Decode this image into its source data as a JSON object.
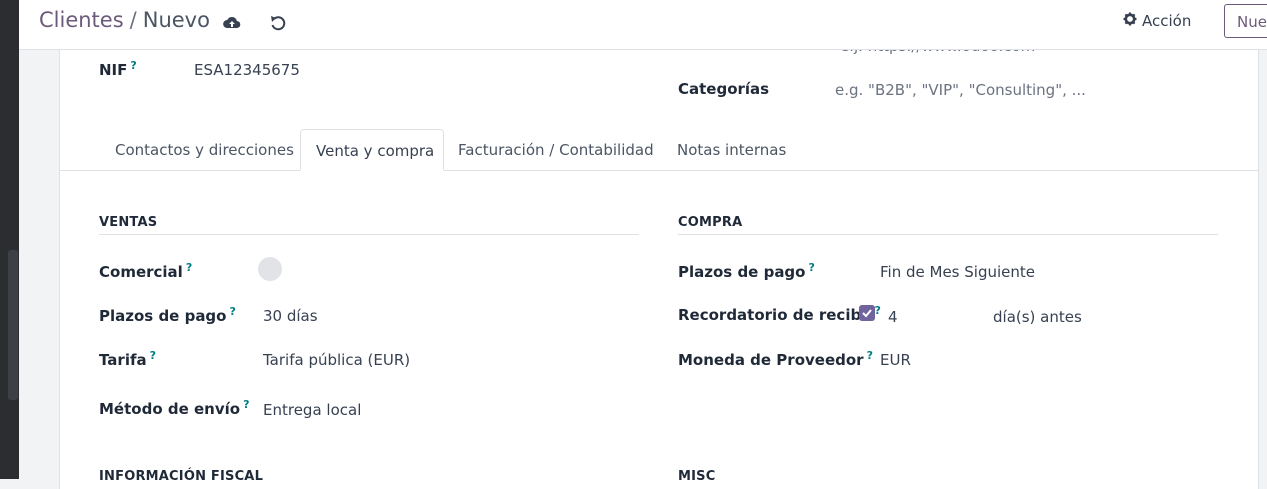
{
  "header": {
    "breadcrumb_parent": "Clientes",
    "breadcrumb_separator": "/",
    "breadcrumb_current": "Nuevo",
    "action_label": "Acción",
    "new_label": "Nue"
  },
  "top_fields": {
    "website_placeholder_fragment": "e.j. https://www.odoo.com",
    "nif_label": "NIF",
    "nif_value": "ESA12345675",
    "categories_label": "Categorías",
    "categories_placeholder": "e.g. \"B2B\", \"VIP\", \"Consulting\", ..."
  },
  "tabs": [
    {
      "label": "Contactos y direcciones"
    },
    {
      "label": "Venta y compra"
    },
    {
      "label": "Facturación / Contabilidad"
    },
    {
      "label": "Notas internas"
    }
  ],
  "help_marker": "?",
  "ventas": {
    "title": "VENTAS",
    "fields": [
      {
        "label": "Comercial",
        "value": ""
      },
      {
        "label": "Plazos de pago",
        "value": "30 días"
      },
      {
        "label": "Tarifa",
        "value": "Tarifa pública (EUR)"
      },
      {
        "label": "Método de envío",
        "value": "Entrega local"
      }
    ]
  },
  "compra": {
    "title": "COMPRA",
    "fields": [
      {
        "label": "Plazos de pago",
        "value": "Fin de Mes Siguiente"
      },
      {
        "label": "Recordatorio de recibo",
        "value": "4",
        "suffix": "día(s) antes",
        "checked": true
      },
      {
        "label": "Moneda de Proveedor",
        "value": "EUR"
      }
    ]
  },
  "lower_sections": {
    "fiscal_title": "INFORMACIÓN FISCAL",
    "misc_title": "MISC"
  },
  "colors": {
    "accent": "#71639e",
    "help": "#017e84",
    "breadcrumb_link": "#6c5a7c"
  }
}
